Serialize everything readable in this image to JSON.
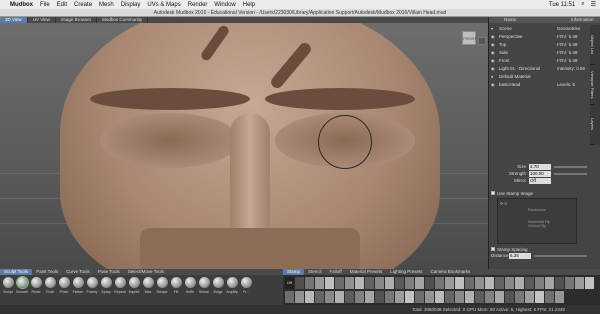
{
  "menubar": {
    "apple": "",
    "app": "Mudbox",
    "items": [
      "File",
      "Edit",
      "Create",
      "Mesh",
      "Display",
      "UVs & Maps",
      "Render",
      "Window",
      "Help"
    ],
    "clock": "Tue 11:51",
    "search_icon": "search-icon",
    "menu_icon": "list-icon"
  },
  "window": {
    "title": "Autodesk Mudbox 2016 - Educational Version - /Users/223030/Library/Application Support/Autodesk/Mudbox 2016/Villain Head.mud"
  },
  "view_tabs": [
    "3D View",
    "UV View",
    "Image Browser",
    "Mudbox Community"
  ],
  "viewport": {
    "viewcube_label": "FRONT"
  },
  "object_list": {
    "headers": [
      "Name",
      "Information"
    ],
    "rows": [
      {
        "name": "Scene",
        "info": "Geometries"
      },
      {
        "name": "Perspective",
        "info": "FOV: 5.49"
      },
      {
        "name": "Top",
        "info": "FOV: 5.49"
      },
      {
        "name": "Side",
        "info": "FOV: 5.49"
      },
      {
        "name": "Front",
        "info": "FOV: 5.49"
      },
      {
        "name": "Light 01 - Directional",
        "info": "Intensity: 0.89"
      },
      {
        "name": "Default Material",
        "info": ""
      },
      {
        "name": "basicHead",
        "info": "Levels: 6"
      }
    ]
  },
  "side_tabs": [
    "Object List",
    "Viewport Filters",
    "Layers"
  ],
  "props": {
    "size_label": "Size",
    "size_value": "4.70",
    "strength_label": "Strength",
    "strength_value": "100.00",
    "mirror_label": "Mirror",
    "mirror_value": "Off"
  },
  "stamp_section": {
    "use_stamp": "Use Stamp Image",
    "randomize": "Randomize",
    "horizontal_flip": "Horizontal Flip",
    "vertical_flip": "Vertical Flip",
    "stamp_spacing": "Stamp Spacing",
    "distance_label": "Distance",
    "distance_value": "6.25",
    "rotate_value": "0"
  },
  "tool_tabs": [
    "Sculpt Tools",
    "Paint Tools",
    "Curve Tools",
    "Pose Tools",
    "Select/Move Tools"
  ],
  "tools": [
    "Sculpt",
    "Smooth",
    "Relax",
    "Grab",
    "Pinch",
    "Flatten",
    "Foamy",
    "Spray",
    "Repeat",
    "Imprint",
    "Wax",
    "Scrape",
    "Fill",
    "Knife",
    "Smear",
    "Bulge",
    "Amplify",
    "Fr..."
  ],
  "stamp_tabs": [
    "Stamp",
    "Stencil",
    "Falloff",
    "Material Presets",
    "Lighting Presets",
    "Camera Bookmarks"
  ],
  "stamp_off_label": "Off",
  "status": "Total: 3050048  Selected: 0  GPU Mem: 60  Active: 5, Highest: 6  FPS: 21.2348"
}
